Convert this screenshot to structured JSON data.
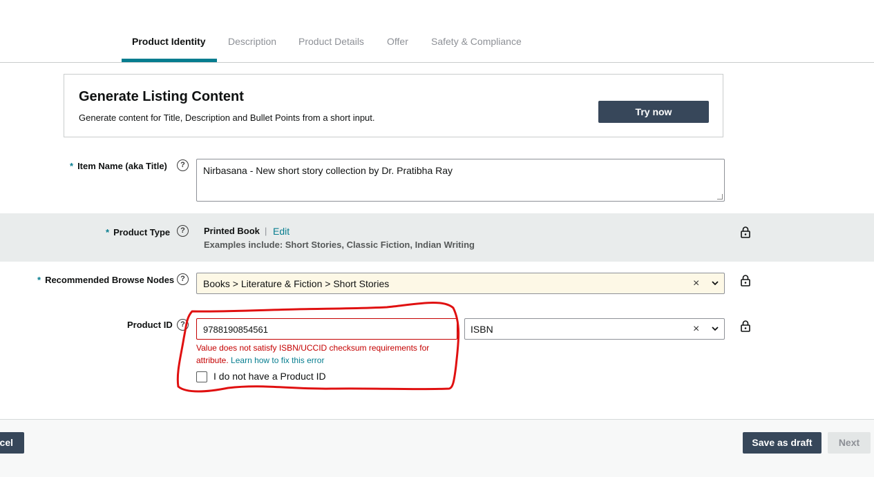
{
  "tabs": [
    {
      "label": "Product Identity",
      "active": true
    },
    {
      "label": "Description",
      "active": false
    },
    {
      "label": "Product Details",
      "active": false
    },
    {
      "label": "Offer",
      "active": false
    },
    {
      "label": "Safety & Compliance",
      "active": false
    }
  ],
  "banner": {
    "title": "Generate Listing Content",
    "subtitle": "Generate content for Title, Description and Bullet Points from a short input.",
    "button_label": "Try now"
  },
  "fields": {
    "item_name": {
      "required_mark": "*",
      "label": "Item Name (aka Title)",
      "value": "Nirbasana - New short story collection by Dr. Pratibha Ray"
    },
    "product_type": {
      "required_mark": "*",
      "label": "Product Type",
      "value": "Printed Book",
      "separator": "|",
      "edit_label": "Edit",
      "examples": "Examples include: Short Stories, Classic Fiction, Indian Writing"
    },
    "browse_nodes": {
      "required_mark": "*",
      "label": "Recommended Browse Nodes",
      "value": "Books > Literature & Fiction > Short Stories",
      "clear": "×"
    },
    "product_id": {
      "label": "Product ID",
      "value": "9788190854561",
      "id_type": "ISBN",
      "clear": "×",
      "error_text": "Value does not satisfy ISBN/UCCID checksum requirements for attribute.",
      "error_link": "Learn how to fix this error",
      "no_id_label": "I do not have a Product ID"
    }
  },
  "help_glyph": "?",
  "footer": {
    "cancel_label": "Cancel",
    "save_draft_label": "Save as draft",
    "next_label": "Next"
  },
  "colors": {
    "accent": "#067d8f",
    "button_dark": "#37475a",
    "error": "#c40000",
    "annotation": "#e01010",
    "highlight_field": "#fdf8e6"
  },
  "icons": [
    "help-icon",
    "lock-icon",
    "clear-icon",
    "chevron-down-icon",
    "checkbox-icon"
  ]
}
